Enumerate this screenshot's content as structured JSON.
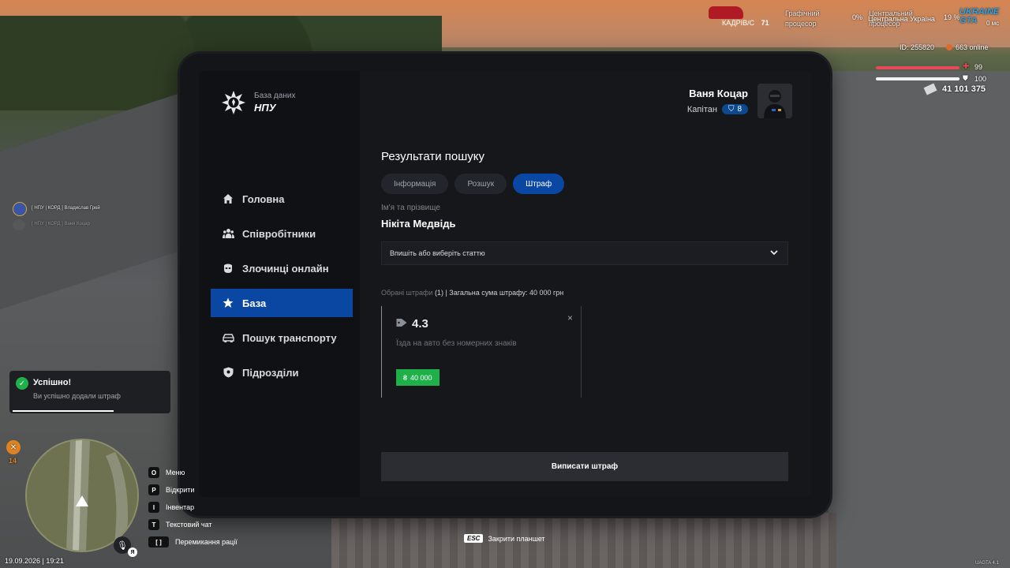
{
  "app": {
    "brand_sub": "База даних",
    "brand_title": "НПУ"
  },
  "user": {
    "name": "Ваня Коцар",
    "rank": "Капітан",
    "level": "8"
  },
  "nav": {
    "items": [
      {
        "label": "Головна",
        "icon": "home-icon"
      },
      {
        "label": "Співробітники",
        "icon": "people-icon"
      },
      {
        "label": "Злочинці онлайн",
        "icon": "mask-icon"
      },
      {
        "label": "База",
        "icon": "star-icon"
      },
      {
        "label": "Пошук транспорту",
        "icon": "car-icon"
      },
      {
        "label": "Підрозділи",
        "icon": "shield-icon"
      }
    ],
    "active_index": 3
  },
  "results": {
    "title": "Результати пошуку",
    "tabs": [
      "Інформація",
      "Розшук",
      "Штраф"
    ],
    "active_tab": 2,
    "name_label": "Ім'я та прізвище",
    "name_value": "Нікіта Медвідь",
    "select_placeholder": "Впишіть або виберіть статтю",
    "summary_label": "Обрані штрафи",
    "summary_count": "(1)",
    "summary_total": "| Загальна сума штрафу: 40 000 грн",
    "fine": {
      "article": "4.3",
      "description": "Їзда на авто без номерних знаків",
      "amount": "40 000",
      "currency_symbol": "₴",
      "close": "×"
    },
    "issue_button": "Виписати штраф"
  },
  "hud": {
    "cadres_label": "КАДРІВ/С",
    "cadres_value": "71",
    "graphics_label": "Графічний процесор",
    "cpu_label": "Центральний процесор",
    "percent_left": "0%",
    "region": "Центральна Україна",
    "percent_right": "19 %",
    "ms": "0 мс",
    "server_logo": "UKRAINE GTA",
    "player_id": "ID: 255820",
    "online": "663 online",
    "health": "99",
    "armor": "100",
    "money": "41 101 375",
    "chat_line_1": "[ НПУ | КОРД ] Владислав Грей",
    "chat_line_2": "[ НПУ | КОРД ] Ваня Коцар",
    "hunger_value": "14",
    "date_time": "19.09.2026 | 19:21",
    "build": "UAGTA 4.1",
    "voice_key": "Я",
    "hotkeys": [
      {
        "key": "O",
        "label": "Меню"
      },
      {
        "key": "P",
        "label": "Відкрити"
      },
      {
        "key": "I",
        "label": "Інвентар"
      },
      {
        "key": "T",
        "label": "Текстовий чат"
      },
      {
        "key": "[ ]",
        "label": "Перемикання рації"
      }
    ],
    "esc_key": "ESC",
    "esc_label": "Закрити планшет"
  },
  "toast": {
    "title": "Успішно!",
    "text": "Ви успішно додали штраф"
  },
  "colors": {
    "accent": "#0a47a3",
    "success": "#1fb04a",
    "health": "#e8475b"
  }
}
